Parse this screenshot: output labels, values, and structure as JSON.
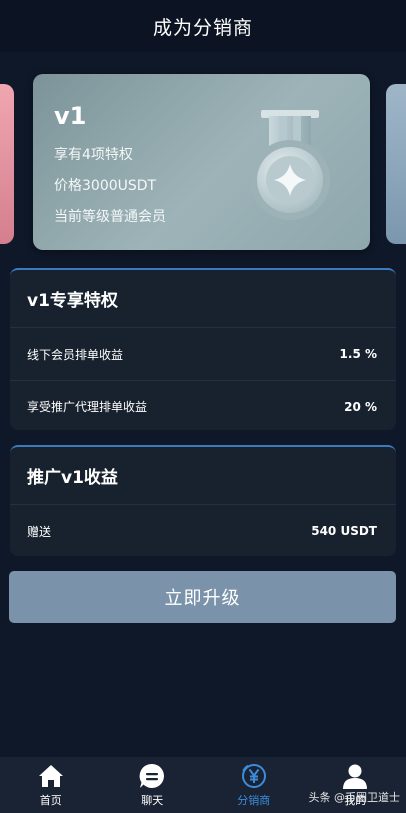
{
  "header": {
    "title": "成为分销商"
  },
  "card": {
    "level": "v1",
    "privileges": "享有4项特权",
    "price": "价格3000USDT",
    "current_level": "当前等级普通会员"
  },
  "privilege_panel": {
    "title": "v1专享特权",
    "rows": [
      {
        "label": "线下会员排单收益",
        "value": "1.5 %"
      },
      {
        "label": "享受推广代理排单收益",
        "value": "20 %"
      }
    ]
  },
  "promo_panel": {
    "title": "推广v1收益",
    "rows": [
      {
        "label": "赠送",
        "value": "540 USDT"
      }
    ]
  },
  "upgrade_button": {
    "label": "立即升级"
  },
  "tabbar": {
    "items": [
      {
        "label": "首页",
        "icon": "home-icon"
      },
      {
        "label": "聊天",
        "icon": "chat-icon"
      },
      {
        "label": "分销商",
        "icon": "yen-icon",
        "active": true
      },
      {
        "label": "我的",
        "icon": "user-icon"
      }
    ]
  },
  "watermark": {
    "text": "头条 @币圈卫道士"
  },
  "colors": {
    "background": "#0f1829",
    "panel": "#18222f",
    "accent": "#3b8ddc",
    "button": "#7a93aa"
  }
}
